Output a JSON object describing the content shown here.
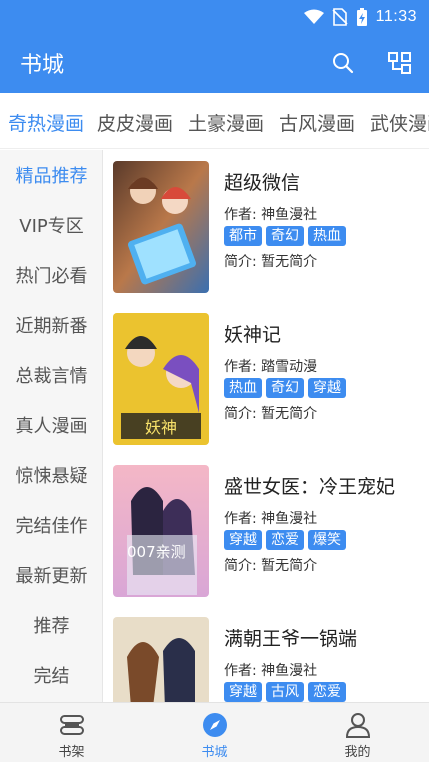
{
  "status_bar": {
    "time": "11:33"
  },
  "app_bar": {
    "title": "书城"
  },
  "tabs": [
    {
      "label": "奇热漫画",
      "active": true
    },
    {
      "label": "皮皮漫画"
    },
    {
      "label": "土豪漫画"
    },
    {
      "label": "古风漫画"
    },
    {
      "label": "武侠漫画"
    }
  ],
  "sidebar": {
    "items": [
      {
        "label": "精品推荐",
        "active": true
      },
      {
        "label": "VIP专区"
      },
      {
        "label": "热门必看"
      },
      {
        "label": "近期新番"
      },
      {
        "label": "总裁言情"
      },
      {
        "label": "真人漫画"
      },
      {
        "label": "惊悚悬疑"
      },
      {
        "label": "完结佳作"
      },
      {
        "label": "最新更新"
      },
      {
        "label": "推荐"
      },
      {
        "label": "完结"
      }
    ]
  },
  "books": [
    {
      "title": "超级微信",
      "author": "作者: 神鱼漫社",
      "tags": [
        "都市",
        "奇幻",
        "热血"
      ],
      "intro": "简介: 暂无简介"
    },
    {
      "title": "妖神记",
      "author": "作者: 踏雪动漫",
      "tags": [
        "热血",
        "奇幻",
        "穿越"
      ],
      "intro": "简介: 暂无简介"
    },
    {
      "title": "盛世女医：冷王宠妃",
      "author": "作者: 神鱼漫社",
      "tags": [
        "穿越",
        "恋爱",
        "爆笑"
      ],
      "intro": "简介: 暂无简介",
      "cover_text": "007亲测"
    },
    {
      "title": "满朝王爷一锅端",
      "author": "作者: 神鱼漫社",
      "tags": [
        "穿越",
        "古风",
        "恋爱"
      ],
      "intro": ""
    }
  ],
  "bottom_nav": [
    {
      "label": "书架",
      "icon": "bookshelf-icon"
    },
    {
      "label": "书城",
      "icon": "compass-icon",
      "active": true
    },
    {
      "label": "我的",
      "icon": "person-icon"
    }
  ],
  "colors": {
    "primary": "#3d8cf0",
    "sidebar_bg": "#f6f6f6",
    "bottom_bg": "#f4f4f4"
  }
}
